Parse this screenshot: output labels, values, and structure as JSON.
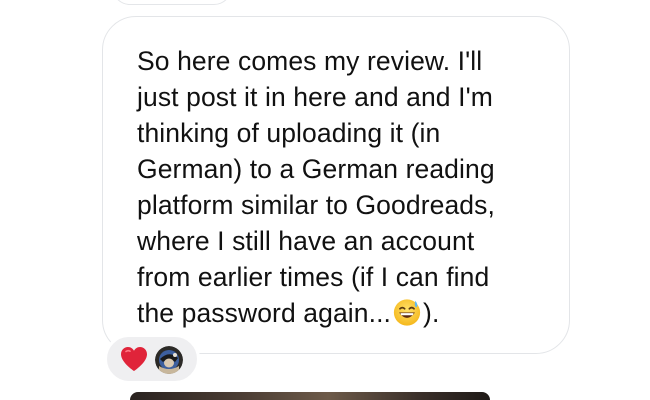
{
  "message": {
    "lines": [
      "So here comes my review. I'll",
      "just post it in here and and I'm",
      "thinking of uploading it (in",
      "German) to a German reading",
      "platform similar to Goodreads,",
      "where I still have an account",
      "from earlier times (if I can find"
    ],
    "last_line_before_emoji": "the password again...",
    "last_line_after_emoji": ")."
  },
  "icons": {
    "inline_emoji": "grinning-sweat-emoji-icon",
    "reaction_1": "red-heart-icon",
    "reaction_2": "user-avatar-icon"
  },
  "colors": {
    "bubble_border": "#e3e5e8",
    "reaction_pill": "#efeff1",
    "text": "#111111",
    "heart": "#e0243a"
  }
}
